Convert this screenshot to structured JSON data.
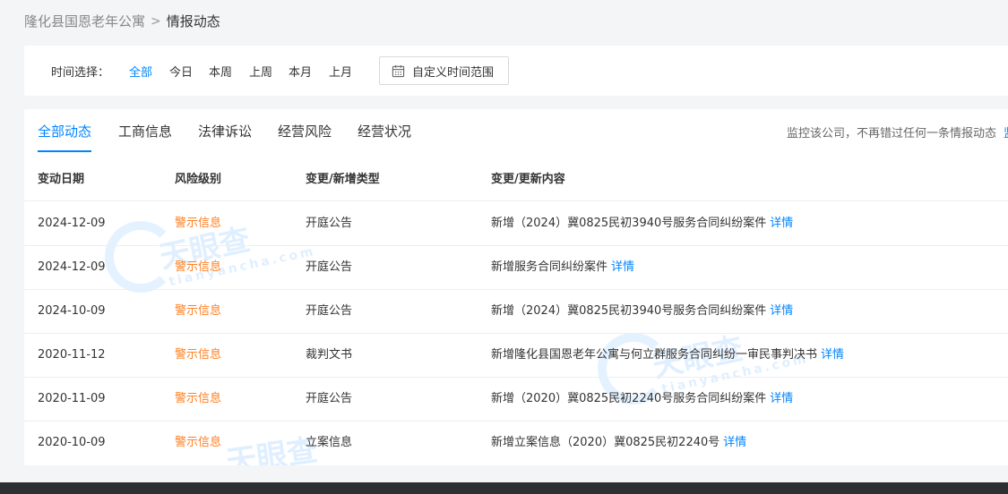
{
  "breadcrumb": {
    "company": "隆化县国恩老年公寓",
    "separator": ">",
    "current": "情报动态"
  },
  "filter": {
    "label": "时间选择：",
    "options": [
      "全部",
      "今日",
      "本周",
      "上周",
      "本月",
      "上月"
    ],
    "active": "全部",
    "custom_button": "自定义时间范围",
    "custom_icon": "calendar-icon"
  },
  "tabs": [
    "全部动态",
    "工商信息",
    "法律诉讼",
    "经营风险",
    "经营状况"
  ],
  "active_tab": "全部动态",
  "monitor": {
    "text": "监控该公司，不再错过任何一条情报动态",
    "link": "监"
  },
  "table": {
    "headers": [
      "变动日期",
      "风险级别",
      "变更/新增类型",
      "变更/更新内容"
    ],
    "rows": [
      {
        "date": "2024-12-09",
        "risk": "警示信息",
        "type": "开庭公告",
        "content": "新增（2024）冀0825民初3940号服务合同纠纷案件",
        "detail": "详情"
      },
      {
        "date": "2024-12-09",
        "risk": "警示信息",
        "type": "开庭公告",
        "content": "新增服务合同纠纷案件",
        "detail": "详情"
      },
      {
        "date": "2024-10-09",
        "risk": "警示信息",
        "type": "开庭公告",
        "content": "新增（2024）冀0825民初3940号服务合同纠纷案件",
        "detail": "详情"
      },
      {
        "date": "2020-11-12",
        "risk": "警示信息",
        "type": "裁判文书",
        "content": "新增隆化县国恩老年公寓与何立群服务合同纠纷一审民事判决书",
        "detail": "详情"
      },
      {
        "date": "2020-11-09",
        "risk": "警示信息",
        "type": "开庭公告",
        "content": "新增（2020）冀0825民初2240号服务合同纠纷案件",
        "detail": "详情"
      },
      {
        "date": "2020-10-09",
        "risk": "警示信息",
        "type": "立案信息",
        "content": "新增立案信息（2020）冀0825民初2240号",
        "detail": "详情"
      }
    ]
  },
  "watermarks": [
    "天眼查",
    "tianyancha.com"
  ],
  "colors": {
    "accent": "#0084ff",
    "risk": "#ff7f22"
  }
}
